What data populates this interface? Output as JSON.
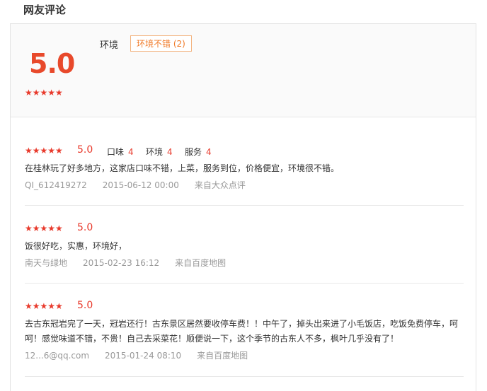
{
  "section_title": "网友评论",
  "summary": {
    "score": "5.0",
    "stars": "★★★★★",
    "tag_label": "环境",
    "tag": "环境不错 (2)"
  },
  "reviews": [
    {
      "stars": "★★★★★",
      "score": "5.0",
      "sub": [
        {
          "label": "口味",
          "value": "4"
        },
        {
          "label": "环境",
          "value": "4"
        },
        {
          "label": "服务",
          "value": "4"
        }
      ],
      "content": "在桂林玩了好多地方，这家店口味不错，上菜，服务到位，价格便宜，环境很不错。",
      "user": "QI_612419272",
      "time": "2015-06-12 00:00",
      "source": "来自大众点评"
    },
    {
      "stars": "★★★★★",
      "score": "5.0",
      "content": "饭很好吃，实惠，环境好，",
      "user": "南天与绿地",
      "time": "2015-02-23 16:12",
      "source": "来自百度地图"
    },
    {
      "stars": "★★★★★",
      "score": "5.0",
      "content": "去古东冠岩完了一天，冠岩还行！古东景区居然要收停车费！！中午了，掉头出来进了小毛饭店，吃饭免费停车，呵呵！感觉味道不错，不贵！自己去采菜花！顺便说一下，这个季节的古东人不多，枫叶几乎没有了！",
      "user": "12...6@qq.com",
      "time": "2015-01-24 08:10",
      "source": "来自百度地图"
    }
  ]
}
